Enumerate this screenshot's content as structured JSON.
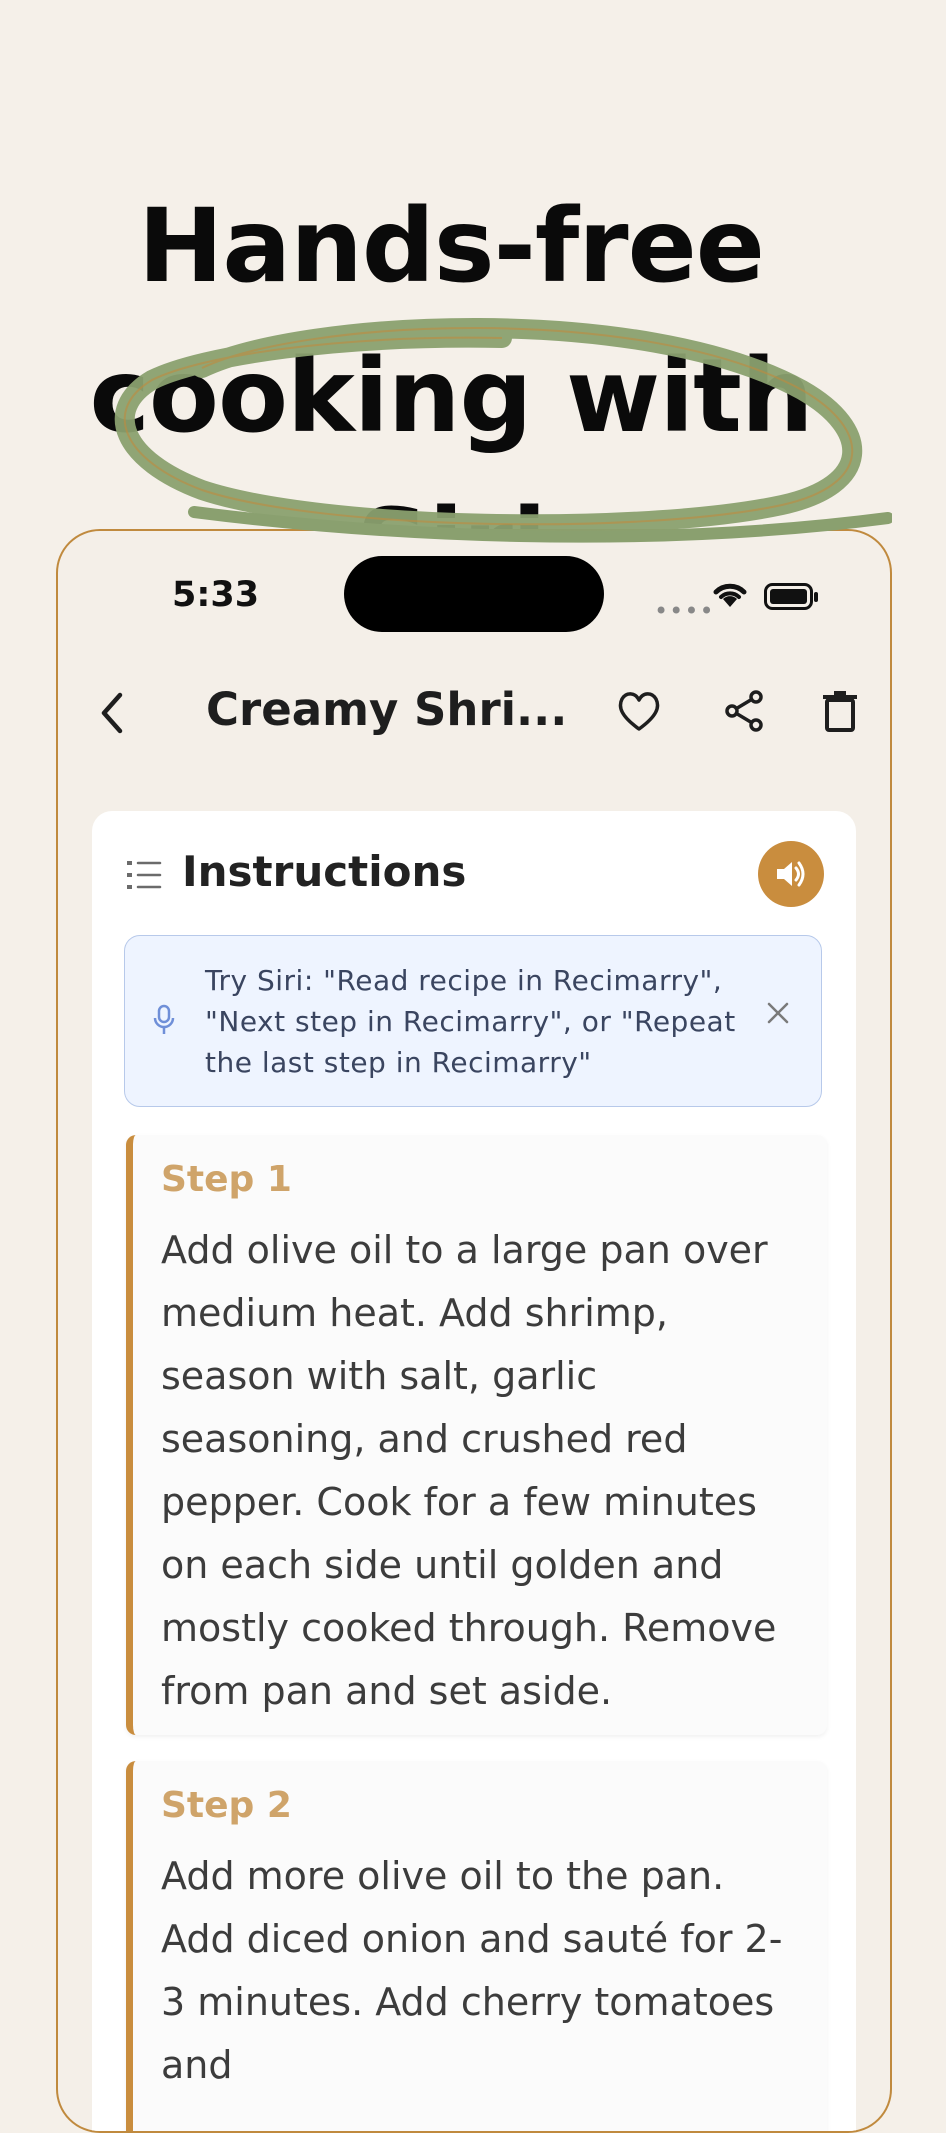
{
  "headline": {
    "line1": "Hands-free",
    "line2": "cooking with Siri"
  },
  "status_bar": {
    "time": "5:33"
  },
  "nav": {
    "title": "Creamy Shri..."
  },
  "instructions": {
    "title": "Instructions",
    "siri_tip": "Try Siri: \"Read recipe in Recimarry\", \"Next step in Recimarry\", or \"Repeat the last step in Recimarry\""
  },
  "steps": [
    {
      "label": "Step 1",
      "text": "Add olive oil to a large pan over medium heat. Add shrimp, season with salt, garlic seasoning, and crushed red pepper. Cook for a few minutes on each side until golden and mostly cooked through. Remove from pan and set aside."
    },
    {
      "label": "Step 2",
      "text": "Add more olive oil to the pan. Add diced onion and sauté for 2-3 minutes. Add cherry tomatoes and"
    }
  ],
  "colors": {
    "accent": "#c98d3e",
    "background": "#f5f0e9",
    "scribble": "#8aa06f"
  }
}
